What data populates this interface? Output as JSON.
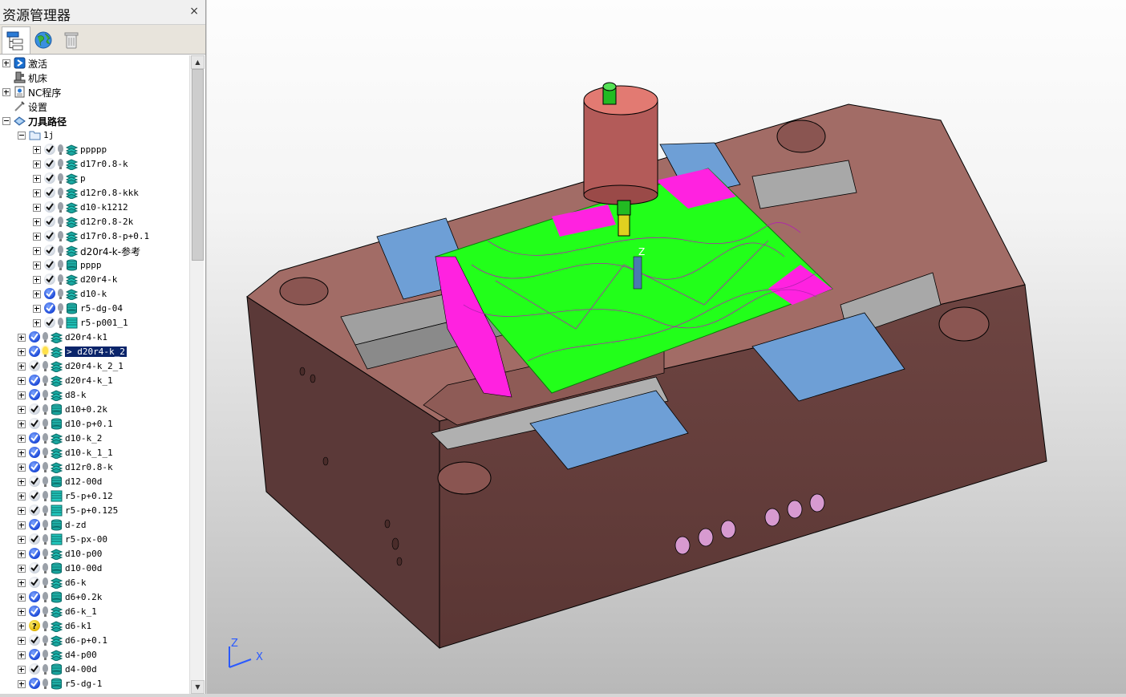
{
  "explorer": {
    "title": "资源管理器",
    "close_label": "×",
    "tabs": [
      {
        "icon": "tree-view-icon",
        "active": true
      },
      {
        "icon": "globe-icon",
        "active": false
      },
      {
        "icon": "trash-icon",
        "active": false
      }
    ]
  },
  "tree": {
    "items": [
      {
        "label": "激活",
        "level": 0,
        "expander": "plus",
        "icon": "activate-icon"
      },
      {
        "label": "机床",
        "level": 0,
        "expander": "none",
        "icon": "machine-icon"
      },
      {
        "label": "NC程序",
        "level": 0,
        "expander": "plus",
        "icon": "nc-program-icon"
      },
      {
        "label": "设置",
        "level": 0,
        "expander": "none",
        "icon": "settings-icon"
      },
      {
        "label": "刀具路径",
        "level": 0,
        "expander": "minus",
        "icon": "toolpath-folder-icon",
        "bold": true
      },
      {
        "label": "1j",
        "level": 1,
        "expander": "minus",
        "icon": "folder-icon"
      },
      {
        "label": "ppppp",
        "level": 2,
        "expander": "plus",
        "status": "ok",
        "type": "layers"
      },
      {
        "label": "d17r0.8-k",
        "level": 2,
        "expander": "plus",
        "status": "ok",
        "type": "layers"
      },
      {
        "label": "p",
        "level": 2,
        "expander": "plus",
        "status": "ok",
        "type": "layers"
      },
      {
        "label": "d12r0.8-kkk",
        "level": 2,
        "expander": "plus",
        "status": "ok",
        "type": "layers"
      },
      {
        "label": "d10-k1212",
        "level": 2,
        "expander": "plus",
        "status": "ok",
        "type": "layers"
      },
      {
        "label": "d12r0.8-2k",
        "level": 2,
        "expander": "plus",
        "status": "ok",
        "type": "layers"
      },
      {
        "label": "d17r0.8-p+0.1",
        "level": 2,
        "expander": "plus",
        "status": "ok",
        "type": "layers"
      },
      {
        "label": "d20r4-k-参考",
        "level": 2,
        "expander": "plus",
        "status": "ok",
        "type": "layers"
      },
      {
        "label": "pppp",
        "level": 2,
        "expander": "plus",
        "status": "ok",
        "type": "stack"
      },
      {
        "label": "d20r4-k",
        "level": 2,
        "expander": "plus",
        "status": "ok",
        "type": "layers"
      },
      {
        "label": "d10-k",
        "level": 2,
        "expander": "plus",
        "status": "blue",
        "type": "layers"
      },
      {
        "label": "r5-dg-04",
        "level": 2,
        "expander": "plus",
        "status": "blue",
        "type": "stack"
      },
      {
        "label": "r5-p001_1",
        "level": 2,
        "expander": "plus",
        "status": "ok",
        "type": "flat"
      },
      {
        "label": "d20r4-k1",
        "level": 1,
        "expander": "plus",
        "status": "blue",
        "type": "layers"
      },
      {
        "label": "> d20r4-k_2",
        "level": 1,
        "expander": "plus",
        "status": "blue",
        "type": "layers",
        "active": true
      },
      {
        "label": "d20r4-k_2_1",
        "level": 1,
        "expander": "plus",
        "status": "ok",
        "type": "layers"
      },
      {
        "label": "d20r4-k_1",
        "level": 1,
        "expander": "plus",
        "status": "blue",
        "type": "layers"
      },
      {
        "label": "d8-k",
        "level": 1,
        "expander": "plus",
        "status": "blue",
        "type": "layers"
      },
      {
        "label": "d10+0.2k",
        "level": 1,
        "expander": "plus",
        "status": "ok",
        "type": "stack"
      },
      {
        "label": "d10-p+0.1",
        "level": 1,
        "expander": "plus",
        "status": "ok",
        "type": "stack"
      },
      {
        "label": "d10-k_2",
        "level": 1,
        "expander": "plus",
        "status": "blue",
        "type": "layers"
      },
      {
        "label": "d10-k_1_1",
        "level": 1,
        "expander": "plus",
        "status": "blue",
        "type": "layers"
      },
      {
        "label": "d12r0.8-k",
        "level": 1,
        "expander": "plus",
        "status": "blue",
        "type": "layers"
      },
      {
        "label": "d12-00d",
        "level": 1,
        "expander": "plus",
        "status": "ok",
        "type": "stack"
      },
      {
        "label": "r5-p+0.12",
        "level": 1,
        "expander": "plus",
        "status": "ok",
        "type": "flat"
      },
      {
        "label": "r5-p+0.125",
        "level": 1,
        "expander": "plus",
        "status": "ok",
        "type": "flat"
      },
      {
        "label": "d-zd",
        "level": 1,
        "expander": "plus",
        "status": "blue",
        "type": "stack"
      },
      {
        "label": "r5-px-00",
        "level": 1,
        "expander": "plus",
        "status": "ok",
        "type": "flat"
      },
      {
        "label": "d10-p00",
        "level": 1,
        "expander": "plus",
        "status": "blue",
        "type": "layers"
      },
      {
        "label": "d10-00d",
        "level": 1,
        "expander": "plus",
        "status": "ok",
        "type": "stack"
      },
      {
        "label": "d6-k",
        "level": 1,
        "expander": "plus",
        "status": "ok",
        "type": "layers"
      },
      {
        "label": "d6+0.2k",
        "level": 1,
        "expander": "plus",
        "status": "blue",
        "type": "stack"
      },
      {
        "label": "d6-k_1",
        "level": 1,
        "expander": "plus",
        "status": "blue",
        "type": "layers"
      },
      {
        "label": "d6-k1",
        "level": 1,
        "expander": "plus",
        "status": "warn",
        "type": "layers"
      },
      {
        "label": "d6-p+0.1",
        "level": 1,
        "expander": "plus",
        "status": "ok",
        "type": "layers"
      },
      {
        "label": "d4-p00",
        "level": 1,
        "expander": "plus",
        "status": "blue",
        "type": "layers"
      },
      {
        "label": "d4-00d",
        "level": 1,
        "expander": "plus",
        "status": "ok",
        "type": "stack"
      },
      {
        "label": "r5-dg-1",
        "level": 1,
        "expander": "plus",
        "status": "blue",
        "type": "stack"
      }
    ]
  },
  "viewport": {
    "triad": {
      "z_label": "Z",
      "x_label": "X"
    },
    "tool_axis_label": "Z",
    "colors": {
      "mold_body": "#7a4d4a",
      "mold_top": "#a36d67",
      "rail_gray": "#9c9c9c",
      "insert_blue": "#6e9fd6",
      "toolpath_green": "#22ff1a",
      "toolpath_magenta": "#ff22e0",
      "tool_holder": "#b35b59",
      "tool_shank": "#22bb22",
      "tool_flute": "#e0d020"
    }
  }
}
